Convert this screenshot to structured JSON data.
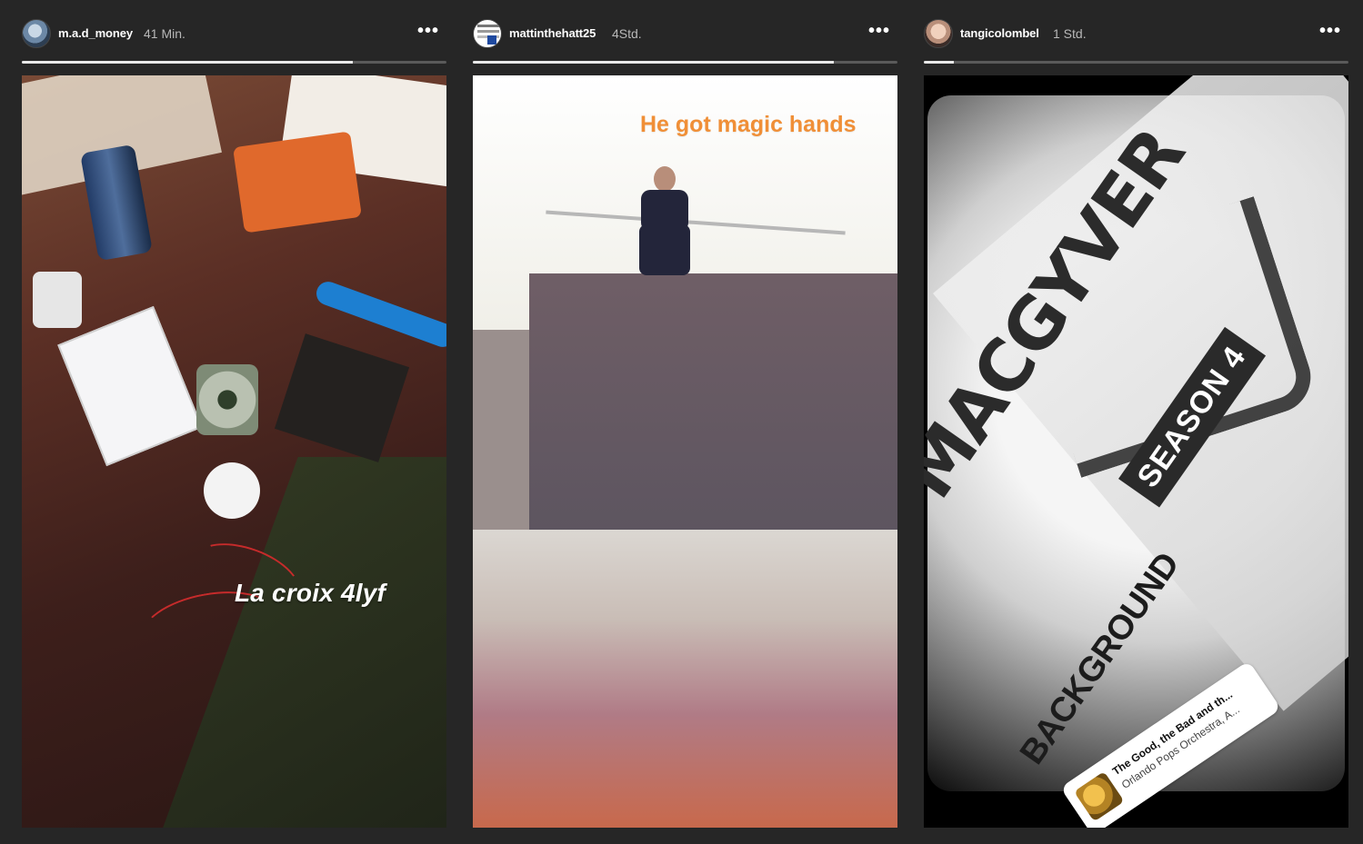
{
  "stories": [
    {
      "username": "m.a.d_money",
      "time": "41 Min.",
      "more_label": "•••",
      "progress": 0.78,
      "caption": "La croix 4lyf"
    },
    {
      "username": "mattinthehatt25",
      "time": "4Std.",
      "more_label": "•••",
      "progress": 0.85,
      "caption": "He got magic hands"
    },
    {
      "username": "tangicolombel",
      "time": "1 Std.",
      "more_label": "•••",
      "progress": 0.07,
      "poster": {
        "macgyver": "MACGYVER",
        "season": "SEASON 4",
        "background": "BACKGROUND"
      },
      "music_sticker": {
        "title": "The Good, the Bad and th...",
        "artist": "Orlando Pops Orchestra, A..."
      }
    }
  ],
  "colors": {
    "background": "#262626",
    "progress_fill": "#e8e8e8",
    "progress_track": "#5a5a5a",
    "caption_orange": "#f08f37"
  }
}
